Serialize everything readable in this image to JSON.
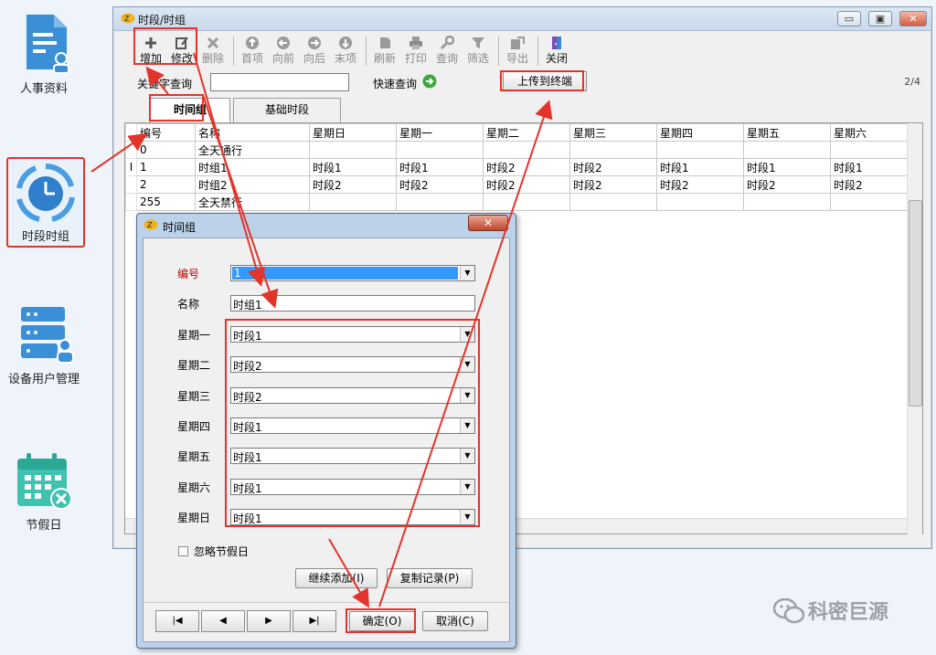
{
  "launcher": {
    "items": [
      {
        "label": "人事资料",
        "icon": "document-person-icon"
      },
      {
        "label": "时段时组",
        "icon": "clock-cycle-icon"
      },
      {
        "label": "设备用户管理",
        "icon": "server-user-icon"
      },
      {
        "label": "节假日",
        "icon": "calendar-cancel-icon"
      }
    ]
  },
  "window": {
    "title": "时段/时组",
    "controls": {
      "minimize": "▭",
      "maximize": "▣",
      "close": "✕"
    },
    "toolbar": [
      {
        "label": "增加",
        "icon": "plus-icon"
      },
      {
        "label": "修改",
        "icon": "edit-icon"
      },
      {
        "label": "删除",
        "icon": "delete-icon"
      },
      {
        "label": "首项",
        "icon": "first-icon"
      },
      {
        "label": "向前",
        "icon": "prev-icon"
      },
      {
        "label": "向后",
        "icon": "next-icon"
      },
      {
        "label": "末项",
        "icon": "last-icon"
      },
      {
        "label": "刷新",
        "icon": "refresh-icon"
      },
      {
        "label": "打印",
        "icon": "print-icon"
      },
      {
        "label": "查询",
        "icon": "query-icon"
      },
      {
        "label": "筛选",
        "icon": "filter-icon"
      },
      {
        "label": "导出",
        "icon": "export-icon"
      },
      {
        "label": "关闭",
        "icon": "close-door-icon"
      }
    ],
    "search": {
      "keyword_label": "关键字查询",
      "keyword_value": "",
      "quick_label": "快速查询",
      "upload_label": "上传到终端",
      "page": "2/4"
    },
    "tabs": [
      "时间组",
      "基础时段"
    ],
    "table": {
      "columns": [
        "编号",
        "名称",
        "星期日",
        "星期一",
        "星期二",
        "星期三",
        "星期四",
        "星期五",
        "星期六"
      ],
      "rows": [
        [
          "0",
          "全天通行",
          "",
          "",
          "",
          "",
          "",
          "",
          ""
        ],
        [
          "1",
          "时组1",
          "时段1",
          "时段1",
          "时段2",
          "时段2",
          "时段1",
          "时段1",
          "时段1"
        ],
        [
          "2",
          "时组2",
          "时段2",
          "时段2",
          "时段2",
          "时段2",
          "时段2",
          "时段2",
          "时段2"
        ],
        [
          "255",
          "全天禁行",
          "",
          "",
          "",
          "",
          "",
          "",
          ""
        ]
      ],
      "current_row_marker": "I"
    }
  },
  "dialog": {
    "title": "时间组",
    "close_label": "✕",
    "fields": {
      "id": {
        "label": "编号",
        "value": "1"
      },
      "name": {
        "label": "名称",
        "value": "时组1"
      },
      "days": [
        {
          "label": "星期一",
          "value": "时段1"
        },
        {
          "label": "星期二",
          "value": "时段2"
        },
        {
          "label": "星期三",
          "value": "时段2"
        },
        {
          "label": "星期四",
          "value": "时段1"
        },
        {
          "label": "星期五",
          "value": "时段1"
        },
        {
          "label": "星期六",
          "value": "时段1"
        },
        {
          "label": "星期日",
          "value": "时段1"
        }
      ]
    },
    "ignore_holiday_label": "忽略节假日",
    "continue_add_label": "继续添加(I)",
    "copy_record_label": "复制记录(P)",
    "confirm_label": "确定(O)",
    "cancel_label": "取消(C)",
    "nav": [
      "|◀",
      "◀",
      "▶",
      "▶|"
    ]
  },
  "watermark": "科密巨源",
  "colors": {
    "annotation": "#e3342b",
    "selection": "#3399ff",
    "required_label": "#c00000"
  }
}
